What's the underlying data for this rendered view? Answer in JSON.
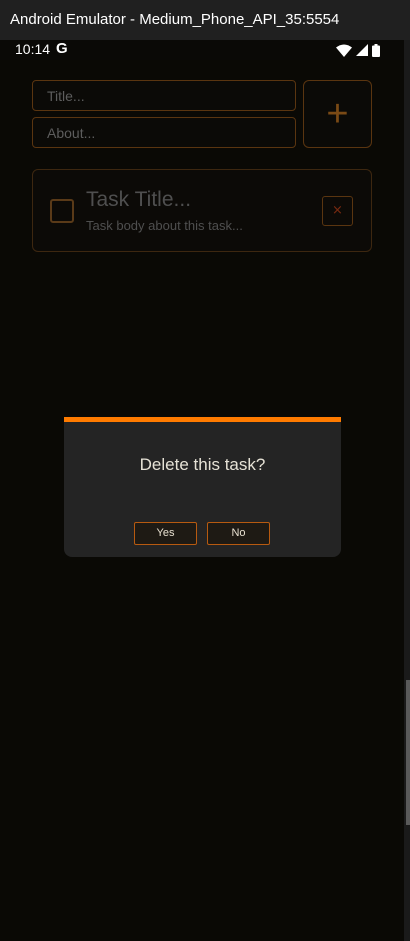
{
  "window": {
    "title": "Android Emulator - Medium_Phone_API_35:5554"
  },
  "status_bar": {
    "time": "10:14",
    "google_badge": "G",
    "icons": [
      "wifi-icon",
      "cellular-signal-icon",
      "battery-icon"
    ]
  },
  "form": {
    "title_placeholder": "Title...",
    "about_placeholder": "About...",
    "add_label": "+"
  },
  "task": {
    "title": "Task Title...",
    "body": "Task body about this task...",
    "delete_label": "×",
    "checked": false
  },
  "dialog": {
    "message": "Delete this task?",
    "yes_label": "Yes",
    "no_label": "No"
  },
  "colors": {
    "accent": "#ff7b00",
    "border": "#5a3510",
    "dialog_bg": "#242424"
  }
}
